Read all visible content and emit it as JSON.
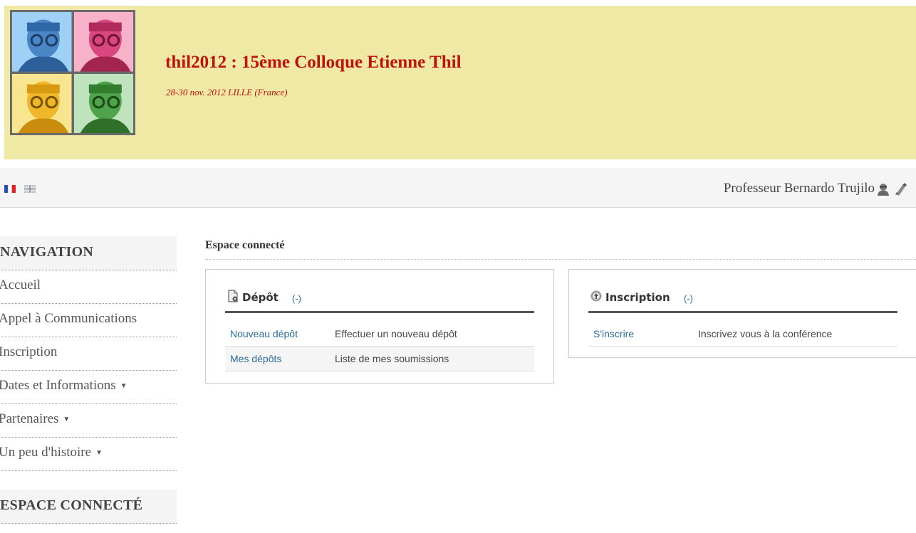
{
  "header": {
    "title": "thil2012 : 15ème Colloque Etienne Thil",
    "subtitle": "28-30 nov. 2012 LILLE (France)",
    "logo_tiles": [
      "#9fd0f5",
      "#f7b1c8",
      "#f7d86a",
      "#9fd39a"
    ]
  },
  "userbar": {
    "user_name": "Professeur Bernardo Trujilo",
    "icons": [
      "profile-icon",
      "logout-icon"
    ],
    "flags": [
      "fr-flag-icon",
      "uk-flag-icon"
    ]
  },
  "sidebar": {
    "navigation_title": "NAVIGATION",
    "items": [
      {
        "label": "Accueil"
      },
      {
        "label": "Appel à Communications"
      },
      {
        "label": "Inscription"
      },
      {
        "label": "Dates et Informations",
        "has_submenu": true
      },
      {
        "label": "Partenaires",
        "has_submenu": true
      },
      {
        "label": "Un peu d'histoire",
        "has_submenu": true
      }
    ],
    "connected_title": "ESPACE CONNECTÉ"
  },
  "main": {
    "title": "Espace connecté",
    "depot": {
      "title": "Dépôt",
      "toggle": "(-)",
      "rows": [
        {
          "link": "Nouveau dépôt",
          "desc": "Effectuer un nouveau dépôt"
        },
        {
          "link": "Mes dépôts",
          "desc": "Liste de mes soumissions"
        }
      ]
    },
    "inscription": {
      "title": "Inscription",
      "toggle": "(-)",
      "rows": [
        {
          "link": "S'inscrire",
          "desc": "Inscrivez vous à la conférence"
        }
      ]
    }
  },
  "colors": {
    "banner_bg": "#f0e9a6",
    "title_red": "#c0120c",
    "link_blue": "#2a6d9e"
  }
}
